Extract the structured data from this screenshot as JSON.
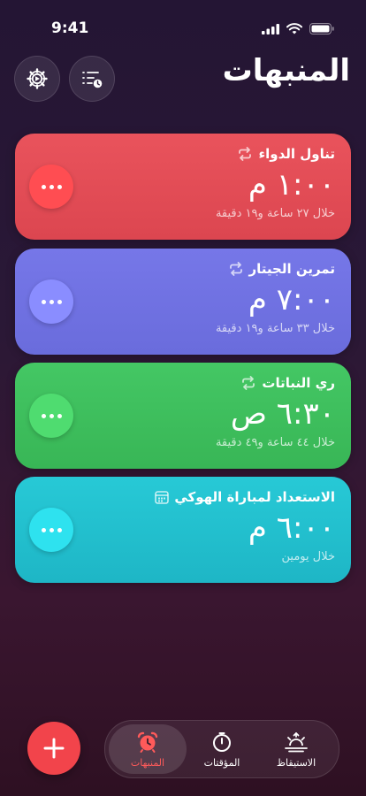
{
  "status_bar": {
    "time": "9:41"
  },
  "header": {
    "title": "المنبهات"
  },
  "alarms": [
    {
      "name": "تناول الدواء",
      "time": "١:٠٠ م",
      "remaining": "خلال ٢٧ ساعة و١٩ دقيقة",
      "icon": "repeat-icon",
      "color": "#e4505a"
    },
    {
      "name": "تمرين الجيتار",
      "time": "٧:٠٠ م",
      "remaining": "خلال ٣٣ ساعة و١٩ دقيقة",
      "icon": "repeat-icon",
      "color": "#6f6fe0"
    },
    {
      "name": "ري النباتات",
      "time": "٦:٣٠ ص",
      "remaining": "خلال ٤٤ ساعة و٤٩ دقيقة",
      "icon": "repeat-icon",
      "color": "#3ebd5c"
    },
    {
      "name": "الاستعداد لمباراة الهوكي",
      "time": "٦:٠٠ م",
      "remaining": "خلال يومين",
      "icon": "calendar-icon",
      "color": "#22c3cf"
    }
  ],
  "tabs": [
    {
      "label": "المنبهات",
      "icon": "alarm-clock-icon",
      "active": true
    },
    {
      "label": "المؤقتات",
      "icon": "timer-icon",
      "active": false
    },
    {
      "label": "الاستيقاظ",
      "icon": "sunrise-icon",
      "active": false
    }
  ],
  "colors": {
    "accent": "#f2444b",
    "active_tab_label": "#ff5a5a"
  }
}
